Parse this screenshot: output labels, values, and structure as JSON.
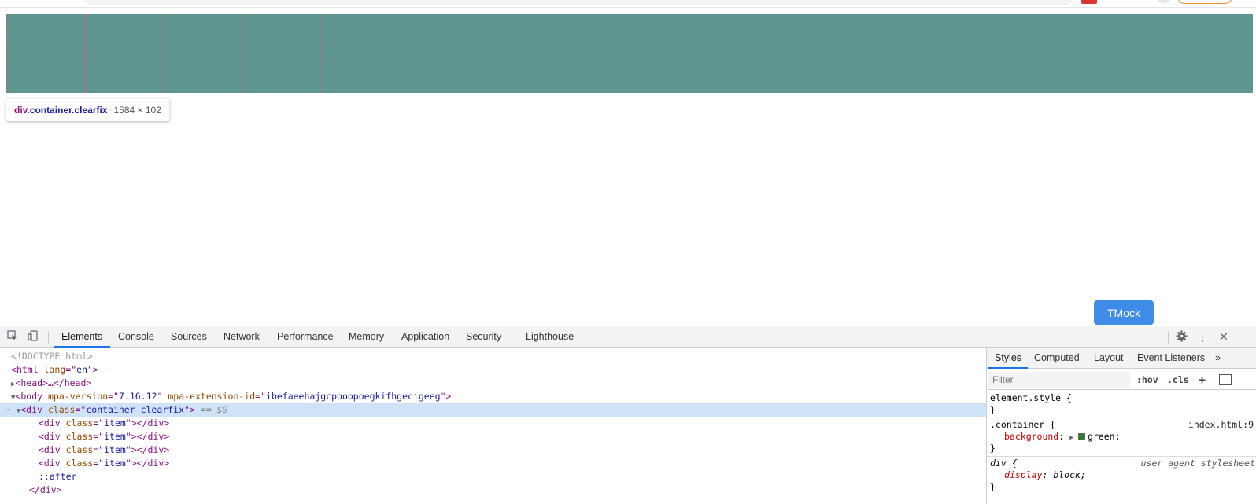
{
  "tooltip": {
    "tag": "div",
    "classes": ".container.clearfix",
    "size": "1584 × 102"
  },
  "floating_button": {
    "label": "TMock"
  },
  "devtools": {
    "tabs": [
      "Elements",
      "Console",
      "Sources",
      "Network",
      "Performance",
      "Memory",
      "Application",
      "Security",
      "Lighthouse"
    ],
    "active_tab": "Elements",
    "dom": {
      "doctype": "<!DOCTYPE html>",
      "html_open": "<html lang=\"en\">",
      "html_tag": "html",
      "html_attr": "lang",
      "html_val": "en",
      "head": "<head>…</head>",
      "body_tag": "body",
      "body_attr1": "mpa-version",
      "body_val1": "7.16.12",
      "body_attr2": "mpa-extension-id",
      "body_val2": "ibefaeehajgcpooopoegkifhgecigeeg",
      "div_tag": "div",
      "div_attr": "class",
      "div_val": "container clearfix",
      "selected_marker": "== $0",
      "item_val": "item",
      "pseudo": "::after",
      "close_div": "</div>"
    },
    "styles_tabs": [
      "Styles",
      "Computed",
      "Layout",
      "Event Listeners"
    ],
    "filter_placeholder": "Filter",
    "hov": ":hov",
    "cls": ".cls",
    "rules": {
      "element_style": "element.style {",
      "container_selector": ".container {",
      "container_source": "index.html:9",
      "container_prop": "background",
      "container_value": "green;",
      "div_selector": "div {",
      "div_source": "user agent stylesheet",
      "div_prop": "display",
      "div_value": "block;",
      "close": "}"
    }
  },
  "colors": {
    "container_bg": "#5f9790",
    "accent": "#1a73e8",
    "tmock": "#3e8ce8"
  }
}
